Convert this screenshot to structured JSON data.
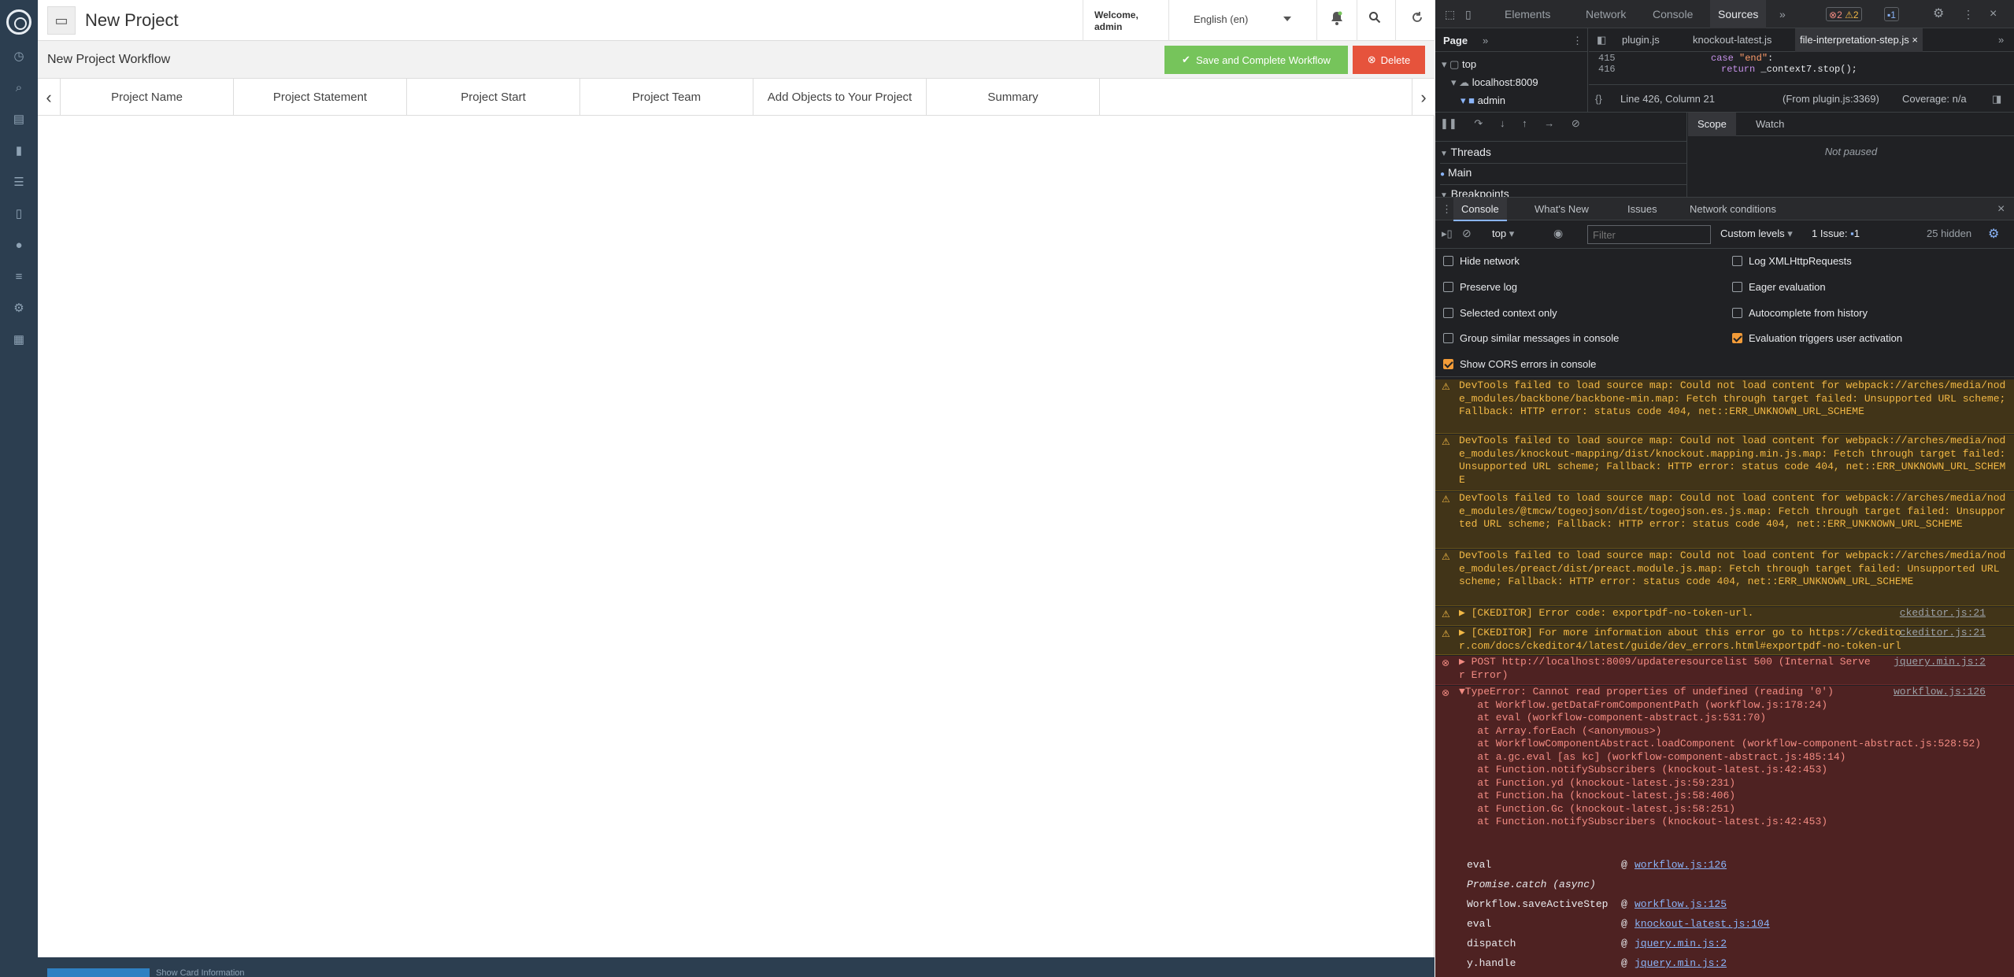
{
  "app": {
    "title": "New Project",
    "welcome_line1": "Welcome,",
    "welcome_line2": "admin",
    "language": "English (en)",
    "workflow_title": "New Project Workflow",
    "save_label": "Save and Complete Workflow",
    "delete_label": "Delete",
    "tabs": [
      "Project Name",
      "Project Statement",
      "Project Start",
      "Project Team",
      "Add Objects to Your Project",
      "Summary"
    ],
    "footer_text": "Show Card Information"
  },
  "devtools": {
    "top_tabs": [
      "Elements",
      "Network",
      "Console",
      "Sources"
    ],
    "active_top_tab": "Sources",
    "errors_count": "2",
    "warnings_count": "2",
    "messages_count": "1",
    "page_tab": "Page",
    "tree": [
      "top",
      "localhost:8009",
      "admin"
    ],
    "editor_tabs": [
      "plugin.js",
      "knockout-latest.js",
      "file-interpretation-step.js"
    ],
    "code_lines": [
      {
        "n": "415",
        "text": "case \"end\":"
      },
      {
        "n": "416",
        "text": "return _context7.stop();"
      }
    ],
    "status_position": "Line 426, Column 21",
    "status_from": "(From plugin.js:3369)",
    "status_coverage": "Coverage: n/a",
    "threads_label": "Threads",
    "thread_main": "Main",
    "breakpoints_label": "Breakpoints",
    "scope_tab": "Scope",
    "watch_tab": "Watch",
    "not_paused": "Not paused",
    "drawer_tabs": [
      "Console",
      "What's New",
      "Issues",
      "Network conditions"
    ],
    "context": "top",
    "filter_placeholder": "Filter",
    "levels": "Custom levels",
    "issue_label": "1 Issue:",
    "issue_count": "1",
    "hidden_count": "25 hidden",
    "settings": [
      {
        "label": "Hide network",
        "checked": false
      },
      {
        "label": "Log XMLHttpRequests",
        "checked": false
      },
      {
        "label": "Preserve log",
        "checked": false
      },
      {
        "label": "Eager evaluation",
        "checked": false
      },
      {
        "label": "Selected context only",
        "checked": false
      },
      {
        "label": "Autocomplete from history",
        "checked": false
      },
      {
        "label": "Group similar messages in console",
        "checked": false
      },
      {
        "label": "Evaluation triggers user activation",
        "checked": true
      },
      {
        "label": "Show CORS errors in console",
        "checked": true
      }
    ],
    "warnings": [
      "DevTools failed to load source map: Could not load content for webpack://arches/media/node_modules/backbone/backbone-min.map: Fetch through target failed: Unsupported URL scheme; Fallback: HTTP error: status code 404, net::ERR_UNKNOWN_URL_SCHEME",
      "DevTools failed to load source map: Could not load content for webpack://arches/media/node_modules/knockout-mapping/dist/knockout.mapping.min.js.map: Fetch through target failed: Unsupported URL scheme; Fallback: HTTP error: status code 404, net::ERR_UNKNOWN_URL_SCHEME",
      "DevTools failed to load source map: Could not load content for webpack://arches/media/node_modules/@tmcw/togeojson/dist/togeojson.es.js.map: Fetch through target failed: Unsupported URL scheme; Fallback: HTTP error: status code 404, net::ERR_UNKNOWN_URL_SCHEME",
      "DevTools failed to load source map: Could not load content for webpack://arches/media/node_modules/preact/dist/preact.module.js.map: Fetch through target failed: Unsupported URL scheme; Fallback: HTTP error: status code 404, net::ERR_UNKNOWN_URL_SCHEME"
    ],
    "ck1": "▶ [CKEDITOR] Error code: exportpdf-no-token-url.",
    "ck1_src": "ckeditor.js:21",
    "ck2": "▶ [CKEDITOR] For more information about this error go to https://ckeditor.com/docs/ckeditor4/latest/guide/dev_errors.html#exportpdf-no-token-url",
    "ck2_src": "ckeditor.js:21",
    "post": "▶ POST http://localhost:8009/updateresourcelist 500 (Internal Server Error)",
    "post_src": "jquery.min.js:2",
    "typeerror": "▼TypeError: Cannot read properties of undefined (reading '0')",
    "typeerror_src": "workflow.js:126",
    "stack": [
      "   at Workflow.getDataFromComponentPath (workflow.js:178:24)",
      "   at eval (workflow-component-abstract.js:531:70)",
      "   at Array.forEach (<anonymous>)",
      "   at WorkflowComponentAbstract.loadComponent (workflow-component-abstract.js:528:52)",
      "   at a.gc.eval [as kc] (workflow-component-abstract.js:485:14)",
      "   at Function.notifySubscribers (knockout-latest.js:42:453)",
      "   at Function.yd (knockout-latest.js:59:231)",
      "   at Function.ha (knockout-latest.js:58:406)",
      "   at Function.Gc (knockout-latest.js:58:251)",
      "   at Function.notifySubscribers (knockout-latest.js:42:453)"
    ],
    "async_rows": [
      {
        "fn": "eval",
        "src": "workflow.js:126"
      },
      {
        "fn": "Promise.catch (async)",
        "src": ""
      },
      {
        "fn": "Workflow.saveActiveStep",
        "src": "workflow.js:125"
      },
      {
        "fn": "eval",
        "src": "knockout-latest.js:104"
      },
      {
        "fn": "dispatch",
        "src": "jquery.min.js:2"
      },
      {
        "fn": "y.handle",
        "src": "jquery.min.js:2"
      }
    ]
  }
}
